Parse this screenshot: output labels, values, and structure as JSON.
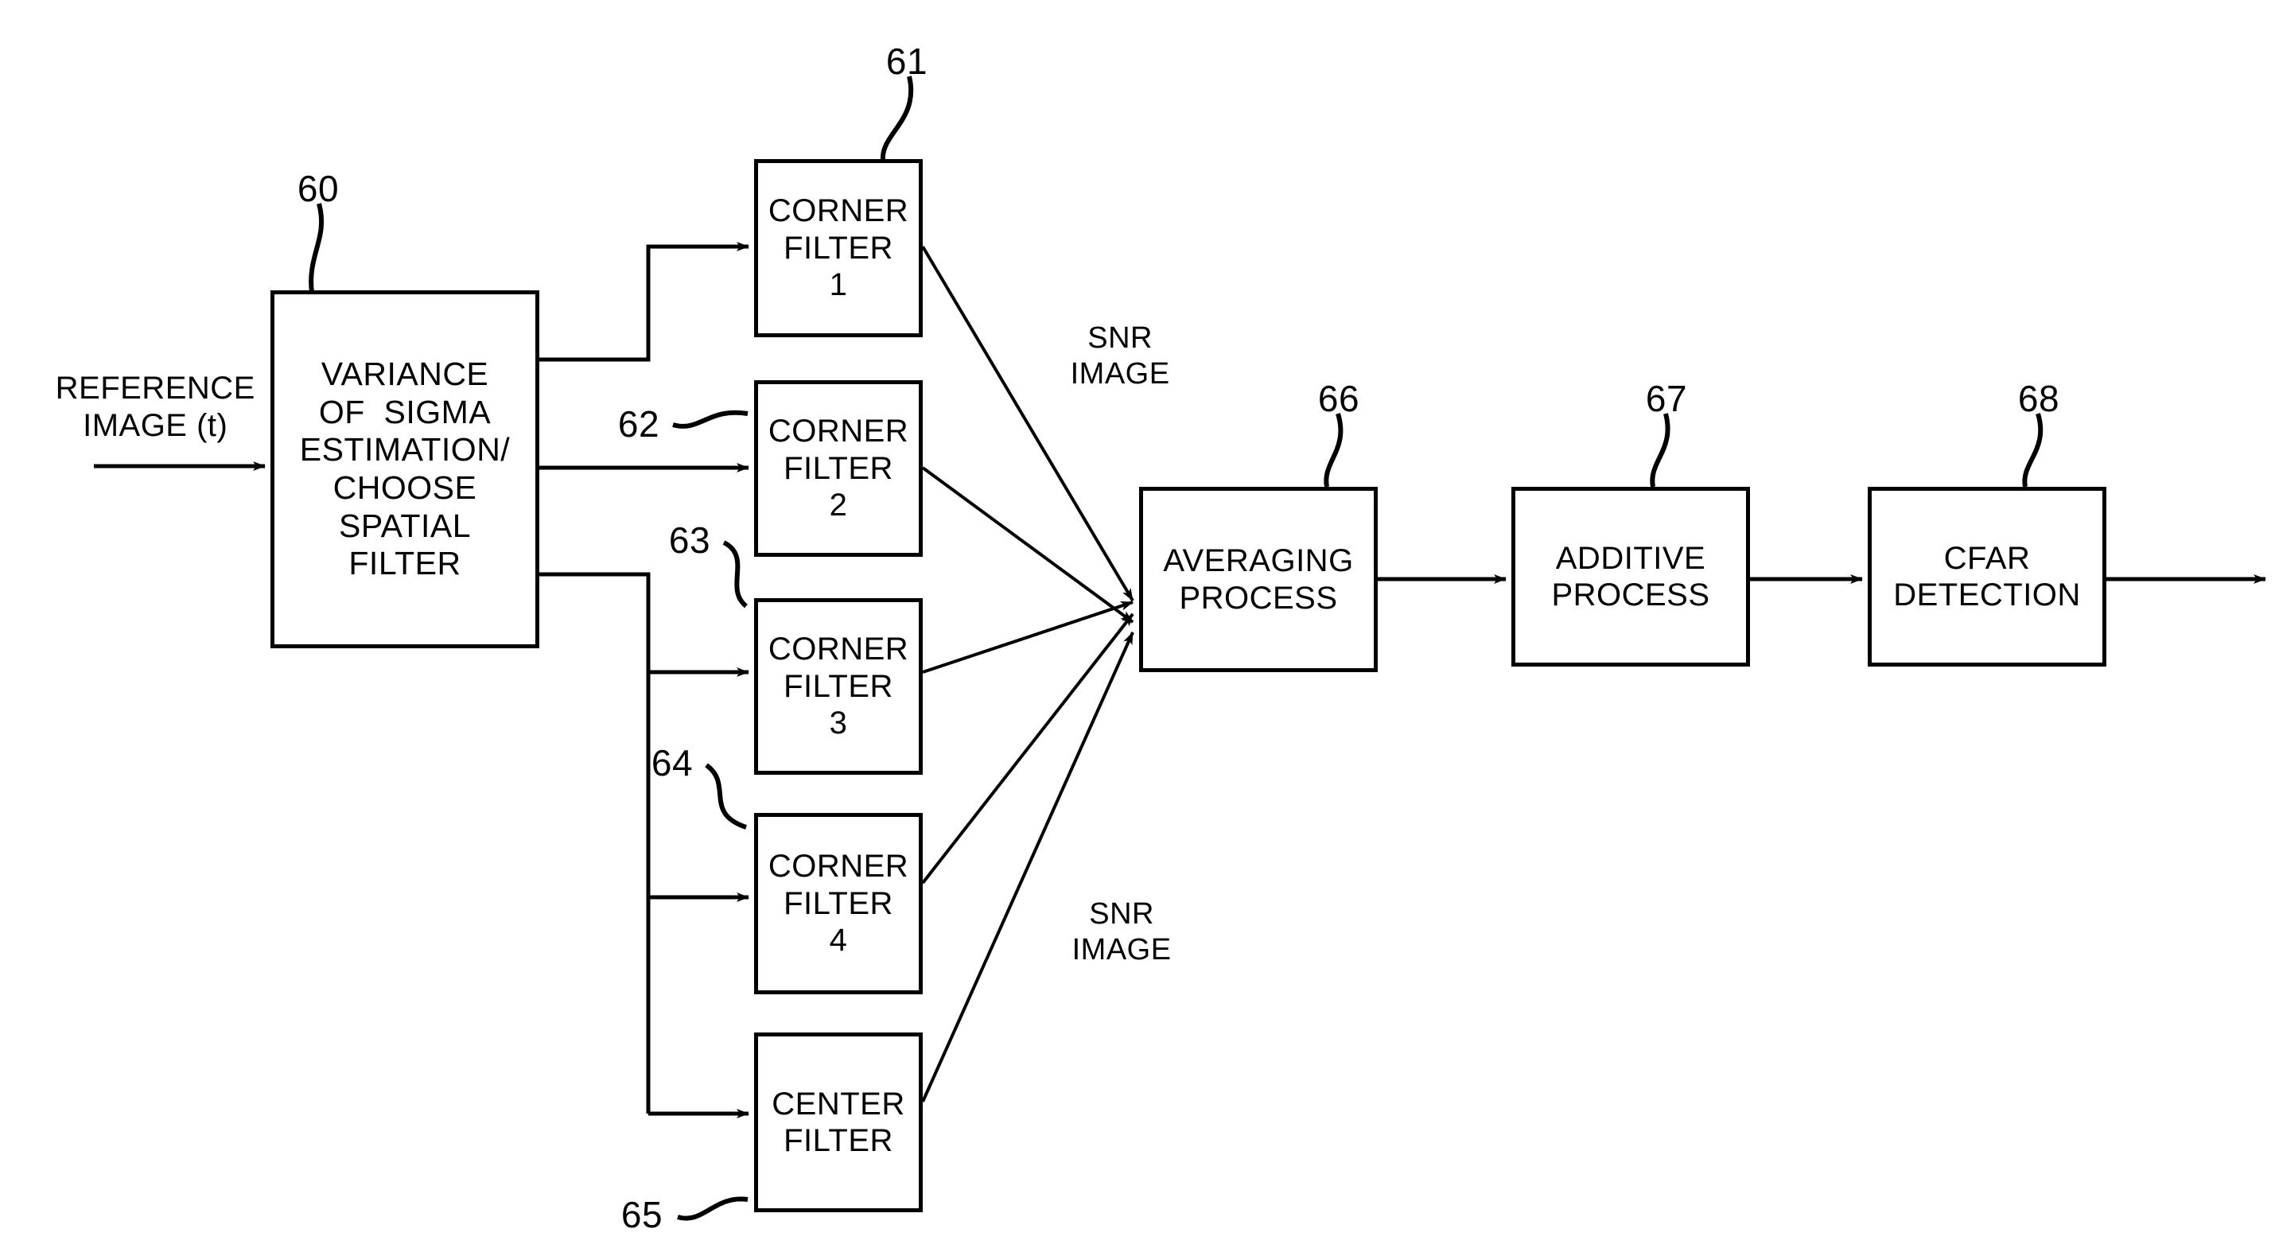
{
  "figure": {
    "type": "block-diagram",
    "title": "",
    "background": "#ffffff",
    "stroke_color": "#000000"
  },
  "input": {
    "label_line1": "REFERENCE",
    "label_line2": "IMAGE (t)",
    "arrow": "input-arrow-right"
  },
  "blocks": [
    {
      "id": "60",
      "ref": "60",
      "lines": [
        "VARIANCE",
        "OF  SIGMA",
        "ESTIMATION/",
        "CHOOSE",
        "SPATIAL",
        "FILTER"
      ]
    },
    {
      "id": "61",
      "ref": "61",
      "lines": [
        "CORNER",
        "FILTER",
        "1"
      ]
    },
    {
      "id": "62",
      "ref": "62",
      "lines": [
        "CORNER",
        "FILTER",
        "2"
      ]
    },
    {
      "id": "63",
      "ref": "63",
      "lines": [
        "CORNER",
        "FILTER",
        "3"
      ]
    },
    {
      "id": "64",
      "ref": "64",
      "lines": [
        "CORNER",
        "FILTER",
        "4"
      ]
    },
    {
      "id": "65",
      "ref": "65",
      "lines": [
        "CENTER",
        "FILTER"
      ]
    },
    {
      "id": "66",
      "ref": "66",
      "lines": [
        "AVERAGING",
        "PROCESS"
      ]
    },
    {
      "id": "67",
      "ref": "67",
      "lines": [
        "ADDITIVE",
        "PROCESS"
      ]
    },
    {
      "id": "68",
      "ref": "68",
      "lines": [
        "CFAR",
        "DETECTION"
      ]
    }
  ],
  "ref_numerals": {
    "n60": "60",
    "n61": "61",
    "n62": "62",
    "n63": "63",
    "n64": "64",
    "n65": "65",
    "n66": "66",
    "n67": "67",
    "n68": "68"
  },
  "edge_labels": {
    "snr_top_line1": "SNR",
    "snr_top_line2": "IMAGE",
    "snr_bottom_line1": "SNR",
    "snr_bottom_line2": "IMAGE"
  }
}
